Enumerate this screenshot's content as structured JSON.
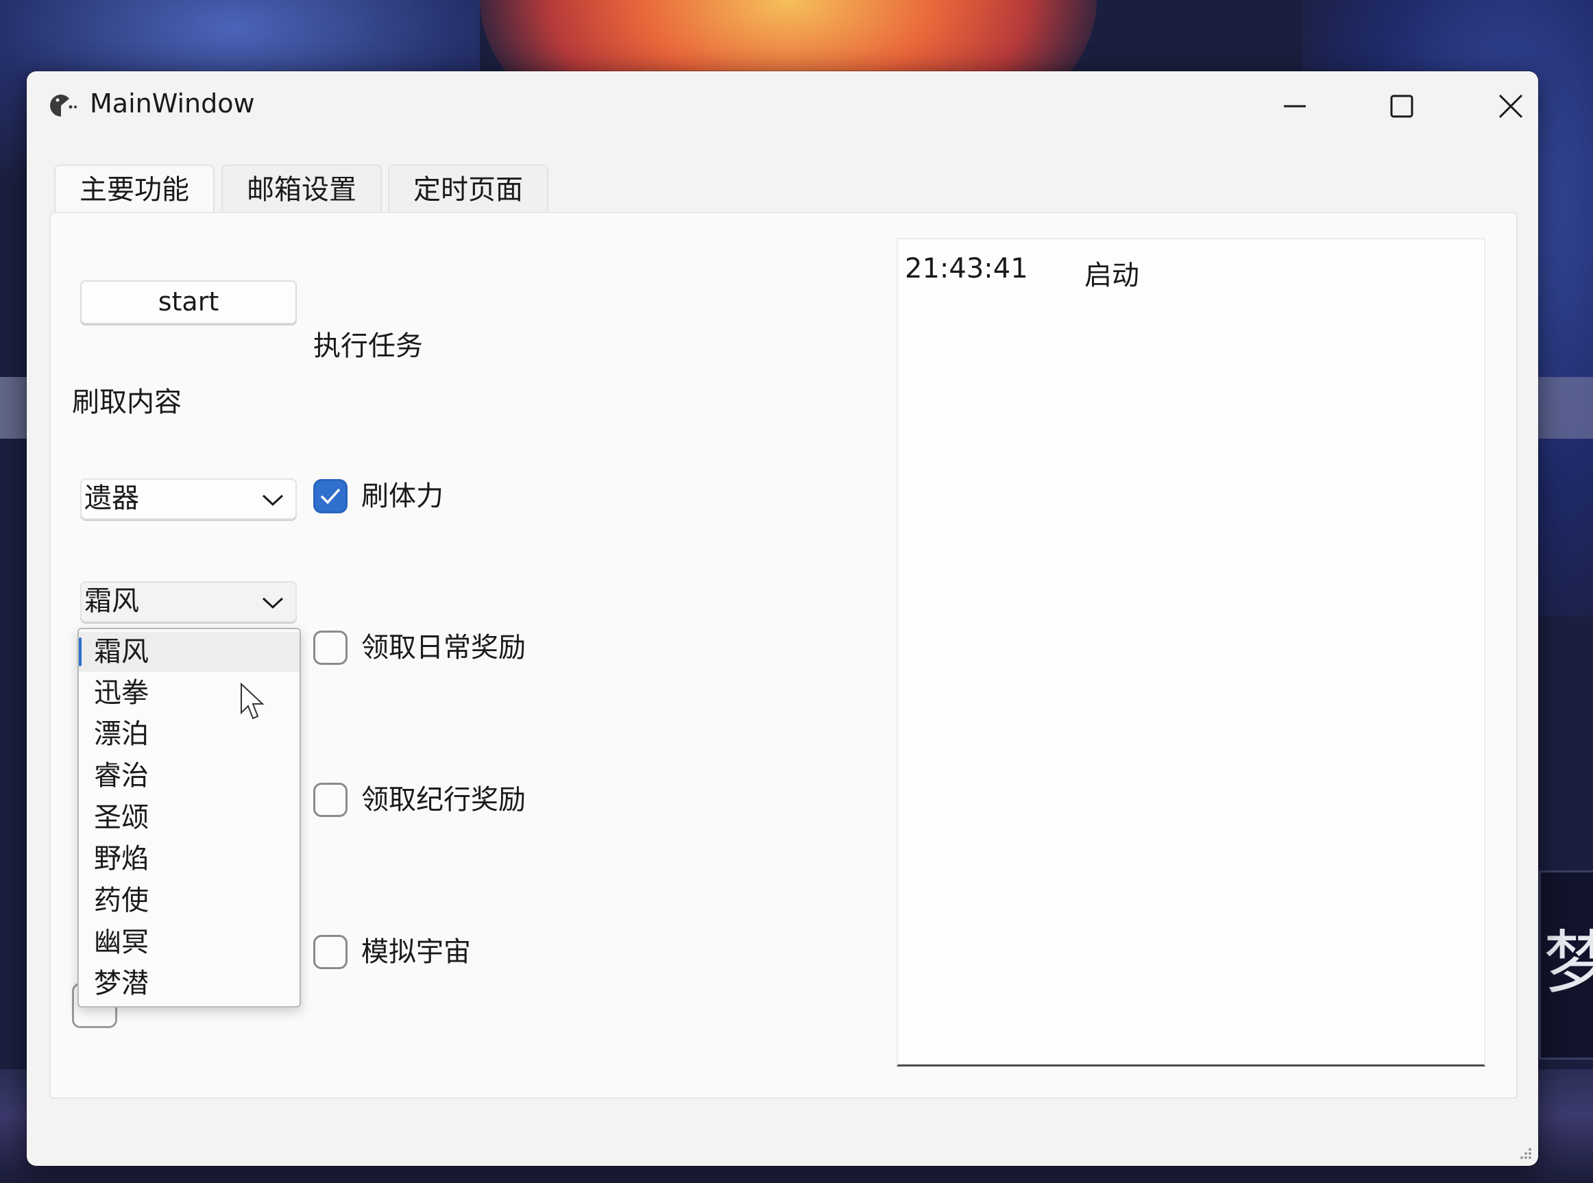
{
  "window": {
    "title": "MainWindow",
    "controls": {
      "minimize": "minimize-icon",
      "maximize": "maximize-icon",
      "close": "close-icon"
    }
  },
  "tabs": [
    {
      "label": "主要功能",
      "active": true
    },
    {
      "label": "邮箱设置",
      "active": false
    },
    {
      "label": "定时页面",
      "active": false
    }
  ],
  "main": {
    "start_label": "start",
    "task_heading": "执行任务",
    "farm_heading": "刷取内容",
    "farm_type": {
      "selected": "遗器"
    },
    "farm_target": {
      "selected": "霜风",
      "options": [
        "霜风",
        "迅拳",
        "漂泊",
        "睿治",
        "圣颂",
        "野焰",
        "药使",
        "幽冥",
        "梦潜"
      ],
      "expanded": true
    },
    "tasks": [
      {
        "label": "刷体力",
        "checked": true
      },
      {
        "label": "领取日常奖励",
        "checked": false
      },
      {
        "label": "领取纪行奖励",
        "checked": false
      },
      {
        "label": "模拟宇宙",
        "checked": false
      }
    ]
  },
  "log": {
    "entries": [
      {
        "time": "21:43:41",
        "message": "启动"
      }
    ]
  },
  "colors": {
    "accent": "#2f6fce",
    "window_bg": "#f3f3f3",
    "text": "#1a1a1a"
  },
  "background_text": "梦"
}
